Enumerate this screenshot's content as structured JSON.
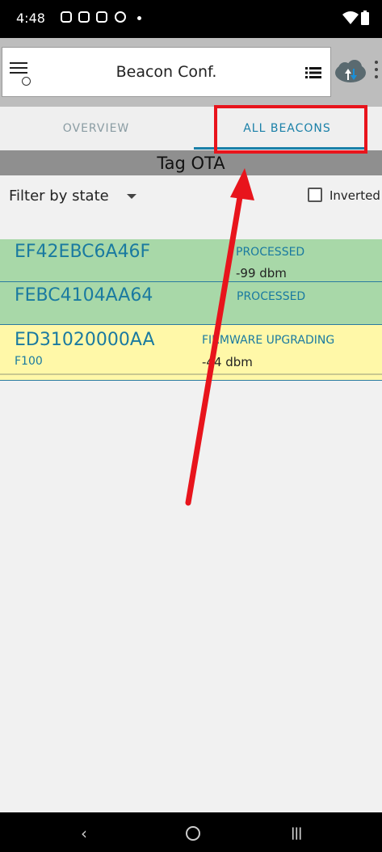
{
  "status_bar": {
    "time": "4:48"
  },
  "app_bar": {
    "title": "Beacon Conf."
  },
  "tabs": [
    {
      "label": "OVERVIEW",
      "selected": false
    },
    {
      "label": "ALL BEACONS",
      "selected": true
    }
  ],
  "section": {
    "title": "Tag OTA"
  },
  "filter": {
    "label": "Filter by state",
    "inverted_label": "Inverted",
    "inverted_checked": false
  },
  "beacons": [
    {
      "id": "EF42EBC6A46F",
      "state": "PROCESSED",
      "rssi": "-99 dbm",
      "model": "",
      "color": "#a8d8a8"
    },
    {
      "id": "FEBC4104AA64",
      "state": "PROCESSED",
      "rssi": "",
      "model": "",
      "color": "#a8d8a8"
    },
    {
      "id": "ED31020000AA",
      "state": "FIRMWARE UPGRADING",
      "rssi": "-44 dbm",
      "model": "F100",
      "color": "#fff8a8"
    }
  ],
  "colors": {
    "accent": "#1a80a8",
    "annotation": "#e8141c"
  }
}
